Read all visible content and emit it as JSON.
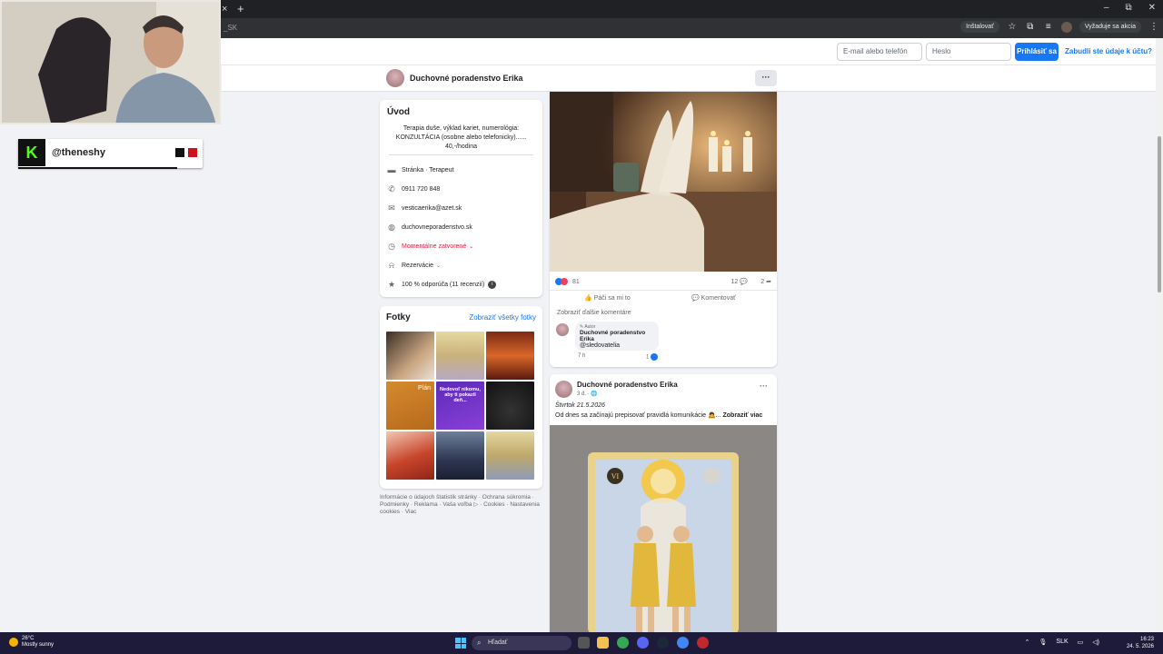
{
  "browser": {
    "tab_close": "×",
    "tab_new": "+",
    "url_fragment": "_SK",
    "install_label": "Inštalovať",
    "update_label": "Vyžaduje sa akcia",
    "win_min": "–",
    "win_max": "⧉",
    "win_close": "✕"
  },
  "login": {
    "email_placeholder": "E-mail alebo telefón",
    "password_placeholder": "Heslo",
    "login_button": "Prihlásiť sa",
    "forgot_link": "Zabudli ste údaje k účtu?"
  },
  "page": {
    "name": "Duchovné poradenstvo Erika",
    "more": "···"
  },
  "intro": {
    "title": "Úvod",
    "bio": "Terapia duše, výklad kariet, numerológia: KONZULTÁCIA (osobne alebo telefonicky)...... 40,-/hodina",
    "category": "Stránka · Terapeut",
    "phone": "0911 720 848",
    "email": "vesticaerika@azet.sk",
    "website": "duchovneporadenstvo.sk",
    "hours_status": "Momentálne zatvorené",
    "reservations": "Rezervácie",
    "rating": "100 % odporúča (11 recenzií)"
  },
  "photos": {
    "title": "Fotky",
    "see_all": "Zobraziť všetky fotky",
    "thumb2_text": "Nedovoľ nikomu, aby ti pokazil deň...",
    "thumb1_text": "Plán"
  },
  "footer": {
    "links": "Informácie o údajoch štatistík stránky · Ochrana súkromia · Podmienky · Reklama · Vaša voľba ▷ · Cookies · Nastavenia cookies · Viac"
  },
  "post1": {
    "reaction_count": "81",
    "comment_count": "12",
    "share_count": "2",
    "like_label": "Páči sa mi to",
    "comment_label": "Komentovať",
    "more_comments": "Zobraziť ďalšie komentáre",
    "comment_badge": "Autor",
    "comment_author": "Duchovné poradenstvo Erika",
    "comment_text": "@sledovatelia",
    "comment_time": "7 h",
    "comment_likes": "1"
  },
  "post2": {
    "author": "Duchovné poradenstvo Erika",
    "meta": "3 d. · 🌐",
    "date_line": "Štvrtok 21.5.2026",
    "text": "Od dnes sa začínajú prepisovať pravidlá komunikácie 🙇...",
    "see_more": "Zobraziť viac",
    "card_number": "VI"
  },
  "overlay": {
    "kick_handle": "@theneshy",
    "kick_letter": "K"
  },
  "taskbar": {
    "temp": "26°C",
    "weather": "Mostly sunny",
    "search": "Hľadať",
    "lang": "SLK",
    "time": "16:23",
    "date": "24. 5. 2026"
  },
  "colors": {
    "fb_blue": "#1877f2",
    "closed_red": "#e41e3f",
    "kick_green": "#53fc18"
  }
}
